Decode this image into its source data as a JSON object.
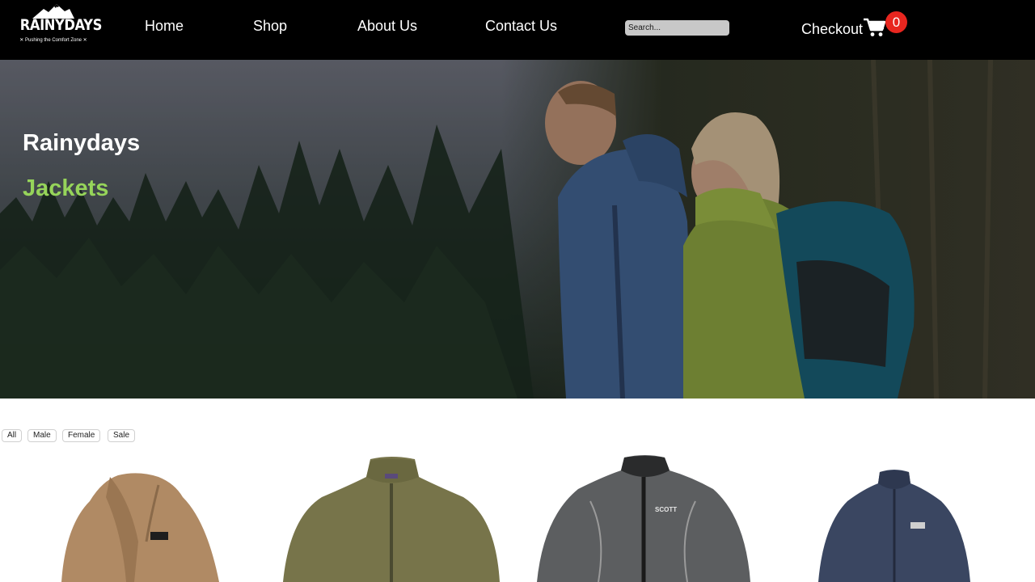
{
  "logo": {
    "word": "RAINYDAYS",
    "tagline": "✕ Pushing the Comfort Zone ✕"
  },
  "nav": {
    "home": "Home",
    "shop": "Shop",
    "about": "About Us",
    "contact": "Contact Us"
  },
  "search": {
    "placeholder": "Search...",
    "value": ""
  },
  "checkout": {
    "label": "Checkout",
    "cart_count": "0",
    "badge_color": "#e8261f"
  },
  "hero": {
    "title": "Rainydays",
    "subtitle": "Jackets",
    "subtitle_color": "#96d45a"
  },
  "filters": [
    "All",
    "Male",
    "Female",
    "Sale"
  ],
  "products": [
    {
      "name": "tan-sherpa-jacket",
      "color": "#b08a64"
    },
    {
      "name": "olive-fleece-jacket",
      "color": "#77744a"
    },
    {
      "name": "gray-scott-windbreaker",
      "color": "#5c5e60",
      "brand_mark": "SCOTT"
    },
    {
      "name": "navy-fleece-jacket",
      "color": "#3a4661"
    }
  ]
}
